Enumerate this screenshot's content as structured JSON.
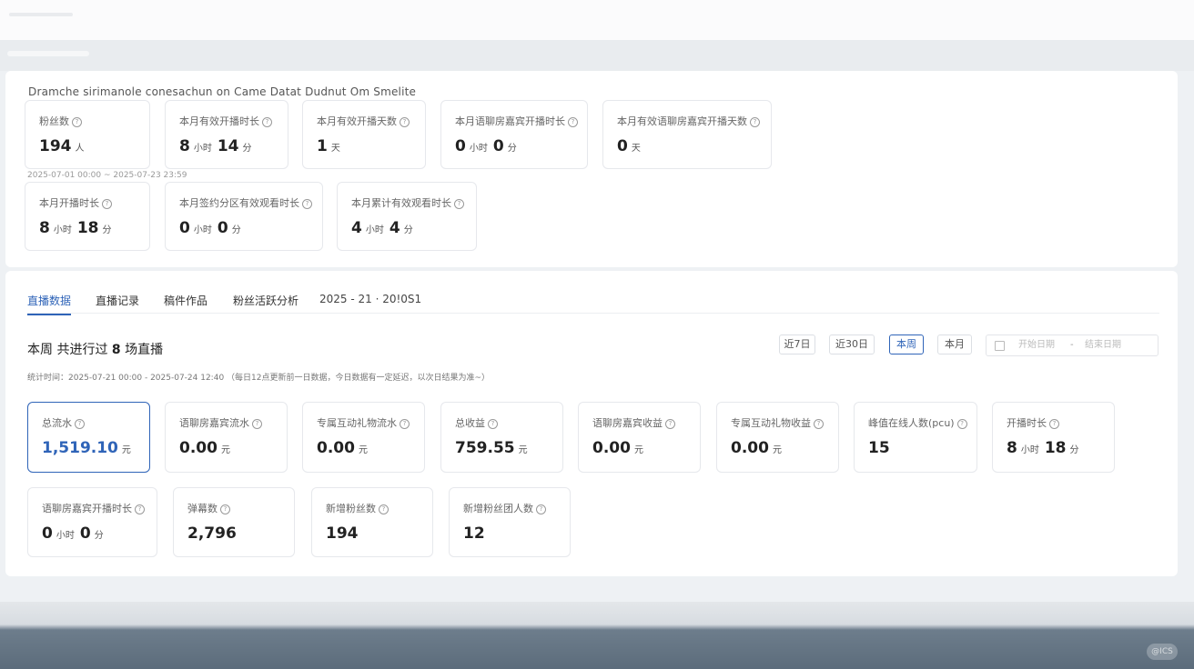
{
  "overview": {
    "title": "Dramche sirimanole conesachun on Came Datat Dudnut Om Smelite",
    "range": "2025-07-01 00:00 ~ 2025-07-23 23:59",
    "cards": [
      {
        "label": "粉丝数",
        "value": "194",
        "unit": "人"
      },
      {
        "label": "本月有效开播时长",
        "value_h": "8",
        "unit_h": "小时",
        "value_m": "14",
        "unit_m": "分"
      },
      {
        "label": "本月有效开播天数",
        "value": "1",
        "unit": "天"
      },
      {
        "label": "本月语聊房嘉宾开播时长",
        "value_h": "0",
        "unit_h": "小时",
        "value_m": "0",
        "unit_m": "分"
      },
      {
        "label": "本月有效语聊房嘉宾开播天数",
        "value": "0",
        "unit": "天"
      },
      {
        "label": "本月开播时长",
        "value_h": "8",
        "unit_h": "小时",
        "value_m": "18",
        "unit_m": "分"
      },
      {
        "label": "本月签约分区有效观看时长",
        "value_h": "0",
        "unit_h": "小时",
        "value_m": "0",
        "unit_m": "分"
      },
      {
        "label": "本月累计有效观看时长",
        "value_h": "4",
        "unit_h": "小时",
        "value_m": "4",
        "unit_m": "分"
      }
    ]
  },
  "tabs": [
    "直播数据",
    "直播记录",
    "稿件作品",
    "粉丝活跃分析",
    "2025 - 21 · 20!0S1"
  ],
  "summary": {
    "prefix": "本周 共进行过",
    "count": "8",
    "suffix": "场直播"
  },
  "stat_time": "统计时间：2025-07-21 00:00 - 2025-07-24 12:40    （每日12点更新前一日数据，今日数据有一定延迟，以次日结果为准~）",
  "range_buttons": [
    "近7日",
    "近30日",
    "本周",
    "本月"
  ],
  "date_input": {
    "start": "开始日期",
    "sep": "-",
    "end": "结束日期"
  },
  "metrics": [
    {
      "label": "总流水",
      "value": "1,519.10",
      "unit": "元"
    },
    {
      "label": "语聊房嘉宾流水",
      "value": "0.00",
      "unit": "元"
    },
    {
      "label": "专属互动礼物流水",
      "value": "0.00",
      "unit": "元"
    },
    {
      "label": "总收益",
      "value": "759.55",
      "unit": "元"
    },
    {
      "label": "语聊房嘉宾收益",
      "value": "0.00",
      "unit": "元"
    },
    {
      "label": "专属互动礼物收益",
      "value": "0.00",
      "unit": "元"
    },
    {
      "label": "峰值在线人数(pcu)",
      "value": "15",
      "unit": ""
    },
    {
      "label": "开播时长",
      "value_h": "8",
      "unit_h": "小时",
      "value_m": "18",
      "unit_m": "分"
    },
    {
      "label": "语聊房嘉宾开播时长",
      "value_h": "0",
      "unit_h": "小时",
      "value_m": "0",
      "unit_m": "分"
    },
    {
      "label": "弹幕数",
      "value": "2,796",
      "unit": ""
    },
    {
      "label": "新增粉丝数",
      "value": "194",
      "unit": ""
    },
    {
      "label": "新增粉丝团人数",
      "value": "12",
      "unit": ""
    }
  ],
  "watermark": "@ICS"
}
